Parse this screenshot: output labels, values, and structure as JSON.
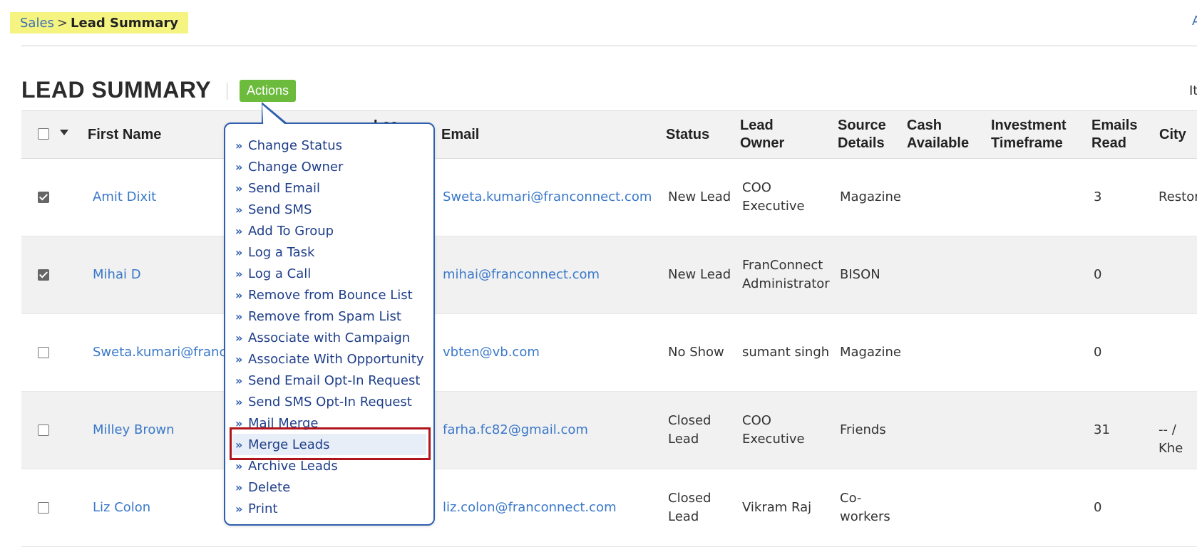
{
  "breadcrumb": {
    "parent": "Sales",
    "separator": ">",
    "current": "Lead Summary"
  },
  "top_right_link": "A",
  "page_title": "LEAD SUMMARY",
  "actions_label": "Actions",
  "items_label": "It",
  "columns": {
    "first_name": "First Name",
    "hidden_col": "Lea",
    "email": "Email",
    "status": "Status",
    "lead_owner": [
      "Lead",
      "Owner"
    ],
    "source_details": [
      "Source",
      "Details"
    ],
    "cash_available": [
      "Cash",
      "Available"
    ],
    "investment_timeframe": [
      "Investment",
      "Timeframe"
    ],
    "emails_read": [
      "Emails",
      "Read"
    ],
    "city": "City"
  },
  "rows": [
    {
      "checked": true,
      "name": "Amit Dixit",
      "email": "Sweta.kumari@franconnect.com",
      "status": [
        "New Lead"
      ],
      "owner": [
        "COO",
        "Executive"
      ],
      "source": [
        "Magazine"
      ],
      "emails_read": "3",
      "city": "Restor"
    },
    {
      "checked": true,
      "name": "Mihai D",
      "email": "mihai@franconnect.com",
      "status": [
        "New Lead"
      ],
      "owner": [
        "FranConnect",
        "Administrator"
      ],
      "source": [
        "BISON"
      ],
      "emails_read": "0",
      "city": ""
    },
    {
      "checked": false,
      "name": "Sweta.kumari@franc",
      "email": "vbten@vb.com",
      "status": [
        "No Show"
      ],
      "owner": [
        "sumant singh"
      ],
      "source": [
        "Magazine"
      ],
      "emails_read": "0",
      "city": ""
    },
    {
      "checked": false,
      "name": "Milley Brown",
      "email": "farha.fc82@gmail.com",
      "status": [
        "Closed",
        "Lead"
      ],
      "owner": [
        "COO",
        "Executive"
      ],
      "source": [
        "Friends"
      ],
      "emails_read": "31",
      "city": "-- / Khe"
    },
    {
      "checked": false,
      "name": "Liz Colon",
      "email": "liz.colon@franconnect.com",
      "status": [
        "Closed",
        "Lead"
      ],
      "owner": [
        "Vikram Raj"
      ],
      "source": [
        "Co-",
        "workers"
      ],
      "emails_read": "0",
      "city": ""
    }
  ],
  "menu": {
    "chevron": "»",
    "items": [
      "Change Status",
      "Change Owner",
      "Send Email",
      "Send SMS",
      "Add To Group",
      "Log a Task",
      "Log a Call",
      "Remove from Bounce List",
      "Remove from Spam List",
      "Associate with Campaign",
      "Associate With Opportunity",
      "Send Email Opt-In Request",
      "Send SMS Opt-In Request",
      "Mail Merge",
      "Merge Leads",
      "Archive Leads",
      "Delete",
      "Print"
    ],
    "highlighted": "Merge Leads"
  },
  "colors": {
    "accent_green": "#6cbb3c",
    "link_blue": "#3a78c9",
    "menu_border": "#2f5fae",
    "highlight_red": "#b0151c",
    "breadcrumb_bg": "#f6f481"
  }
}
